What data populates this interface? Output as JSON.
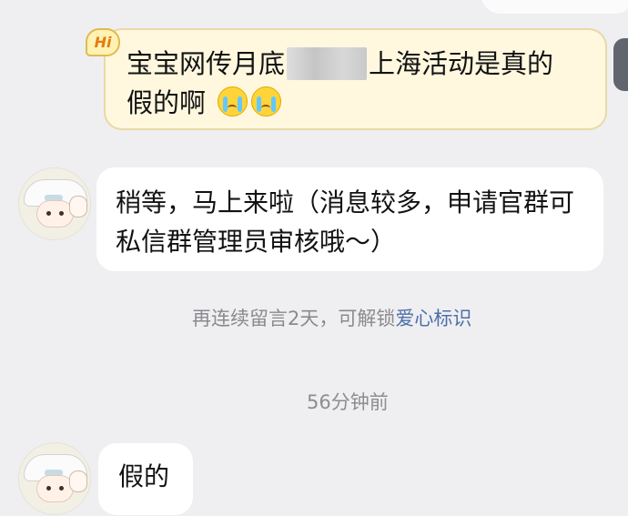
{
  "messages": {
    "mine": {
      "badge": "Hi",
      "line1_before": "宝宝网传月底",
      "line1_after": "上海活动是真的",
      "line2": "假的啊"
    },
    "reply": {
      "text": "稍等，马上来啦（消息较多，申请官群可私信群管理员审核哦～）"
    },
    "note": {
      "prefix": "再连续留言2天，可解锁",
      "link": "爱心标识"
    },
    "timestamp": "56分钟前",
    "short_reply": "假的"
  },
  "icons": {
    "crying_emoji": "crying-face-icon",
    "avatar": "officer-avatar-icon"
  },
  "colors": {
    "background": "#efeff1",
    "mine_bubble": "#fff8df",
    "mine_border": "#e9d9a6",
    "reply_bubble": "#ffffff",
    "link": "#4d6fa9",
    "muted_text": "#8a8a8f"
  }
}
